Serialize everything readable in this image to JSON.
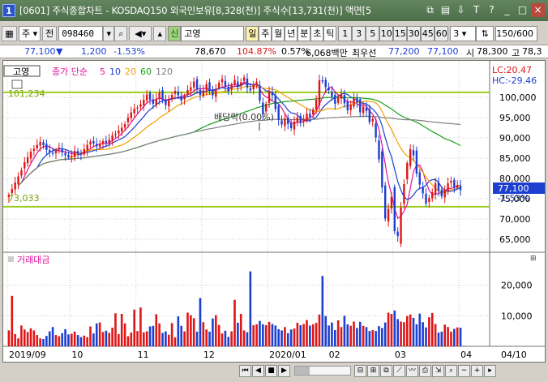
{
  "window": {
    "number": "1",
    "title": "[0601] 주식종합차트 - KOSDAQ150 외국인보유[8,328(천)] 주식수[13,731(천)] 액면[5"
  },
  "toolbar": {
    "market": "주",
    "order": "전",
    "code": "098460",
    "badge": "신",
    "stock_name": "고영",
    "periods": [
      "일",
      "주",
      "월",
      "년",
      "분",
      "초",
      "틱"
    ],
    "active_period": "일",
    "intervals": [
      "1",
      "3",
      "5",
      "10",
      "15",
      "30",
      "45",
      "60"
    ],
    "count_select": "3",
    "view_count": "150",
    "view_total": "/600"
  },
  "quote": {
    "price": "77,100",
    "change": "1,200",
    "change_pct": "-1.53%",
    "prev": "78,670",
    "ratio": "104.87%",
    "pct2": "0.57%",
    "volume_label": "6,068백만",
    "best_ask_label": "최우선",
    "ask": "77,200",
    "bid": "77,100",
    "open_label": "시",
    "open": "78,300",
    "high_label": "고",
    "high": "78,3"
  },
  "chart": {
    "legend_name": "고영",
    "legend_type": "종가 단순",
    "ma_periods": [
      "5",
      "10",
      "20",
      "60",
      "120"
    ],
    "lc": "LC:20.47",
    "hc": "HC:-29.46",
    "hline_high": "101,234",
    "hline_low": "73,033",
    "annotation": "배당락(0.00%)",
    "current_price": "77,100",
    "current_pct": "-1.53%",
    "volume_label": "거래대금",
    "y_price_ticks": [
      "100,000",
      "95,000",
      "90,000",
      "85,000",
      "80,000",
      "75,000",
      "70,000",
      "65,000"
    ],
    "y_volume_ticks": [
      "20,000",
      "10,000"
    ],
    "x_ticks": [
      "2019/09",
      "10",
      "11",
      "12",
      "2020/01",
      "02",
      "03",
      "04",
      "04/10"
    ],
    "colors": {
      "up": "#e01515",
      "down": "#1c3fd1",
      "ma5": "#e0129c",
      "ma10": "#1c3fd1",
      "ma20": "#f3a000",
      "ma60": "#18a018",
      "ma120": "#808080",
      "hline": "#9ccc1c"
    }
  },
  "chart_data": {
    "type": "candlestick",
    "title": "고영",
    "ylim": [
      62000,
      109000
    ],
    "hlines": [
      101234,
      73033
    ],
    "series": [
      {
        "name": "종가",
        "values": [
          76000,
          77400,
          79000,
          80500,
          82000,
          84000,
          85200,
          86600,
          87300,
          88300,
          89000,
          88200,
          87000,
          86500,
          86100,
          86900,
          87600,
          86400,
          85700,
          85200,
          85600,
          86800,
          86100,
          85900,
          87200,
          88300,
          89100,
          88600,
          87900,
          88400,
          89200,
          88800,
          89600,
          90600,
          91000,
          91800,
          92500,
          93400,
          95000,
          96300,
          97200,
          97500,
          98300,
          99400,
          100700,
          99400,
          98400,
          99600,
          101200,
          99400,
          98100,
          99300,
          100600,
          101600,
          100500,
          99200,
          100400,
          101800,
          102500,
          103900,
          101900,
          100600,
          101700,
          103300,
          101700,
          100500,
          102000,
          103600,
          104500,
          102700,
          101500,
          103100,
          104300,
          102800,
          103700,
          104900,
          102400,
          101700,
          103200,
          103800,
          99200,
          95800,
          98400,
          101600,
          100500,
          97100,
          94400,
          93300,
          94800,
          93400,
          92400,
          94000,
          95100,
          93900,
          94700,
          96000,
          95200,
          97000,
          99400,
          104200,
          103900,
          102500,
          101800,
          100200,
          98400,
          99900,
          100800,
          98500,
          96800,
          98200,
          99700,
          98800,
          96300,
          97700,
          96600,
          93900,
          94700,
          90100,
          84700,
          77800,
          70100,
          72500,
          75400,
          67000,
          65800,
          72800,
          78600,
          83800,
          87200,
          85700,
          81200,
          78500,
          76300,
          73800,
          75200,
          76600,
          78800,
          76900,
          75600,
          77200,
          78800,
          79400,
          77800,
          78300,
          77100
        ]
      },
      {
        "name": "거래대금",
        "values": [
          5200,
          16500,
          4000,
          2600,
          6800,
          5500,
          4700,
          5900,
          5200,
          3700,
          2600,
          2400,
          3400,
          4900,
          6300,
          3700,
          3300,
          4300,
          5600,
          3900,
          4100,
          4800,
          3700,
          3000,
          3500,
          3000,
          6500,
          4200,
          7500,
          7800,
          4700,
          5100,
          4400,
          6100,
          10800,
          4000,
          10600,
          7500,
          3300,
          4500,
          12000,
          5000,
          12700,
          4600,
          4900,
          6500,
          6700,
          10500,
          7500,
          4400,
          4900,
          3800,
          7600,
          2900,
          9800,
          6700,
          4900,
          11000,
          10200,
          9200,
          4800,
          15800,
          7900,
          5500,
          4800,
          9100,
          10200,
          7000,
          4200,
          5100,
          3100,
          4900,
          15200,
          7700,
          10600,
          5200,
          4600,
          24500,
          6900,
          7200,
          8300,
          7200,
          6900,
          8000,
          7300,
          6800,
          5600,
          5200,
          6300,
          4300,
          5500,
          5800,
          7700,
          6900,
          7300,
          8600,
          6800,
          7200,
          7700,
          10400,
          23000,
          9900,
          6800,
          7800,
          5300,
          8500,
          6300,
          10000,
          7200,
          6700,
          8100,
          6000,
          8000,
          6700,
          6300,
          5000,
          5300,
          5000,
          6600,
          6000,
          7800,
          11000,
          10600,
          11700,
          8900,
          8100,
          7900,
          9900,
          10400,
          9300,
          7200,
          10700,
          7900,
          6200,
          9500,
          10900,
          7300,
          4500,
          4800,
          7100,
          6300,
          4800,
          5700,
          6200,
          6100
        ]
      }
    ]
  }
}
